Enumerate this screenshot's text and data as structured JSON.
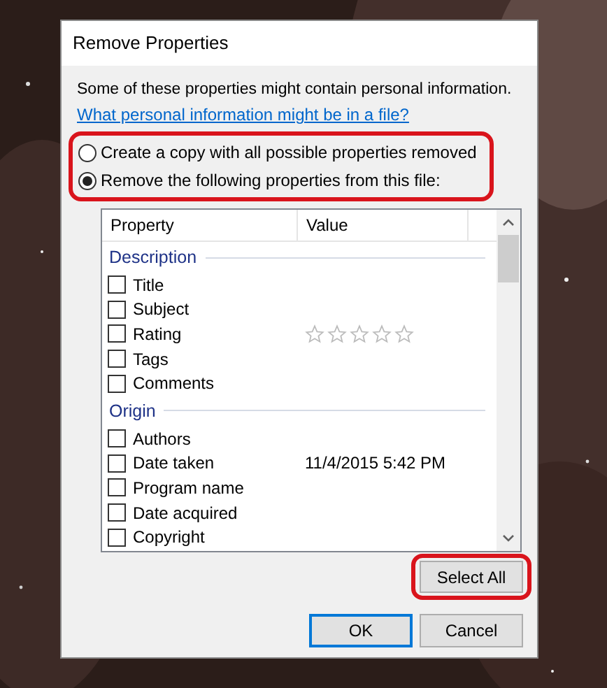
{
  "dialog": {
    "title": "Remove Properties",
    "intro": "Some of these properties might contain personal information.",
    "link": "What personal information might be in a file?",
    "options": [
      {
        "label": "Create a copy with all possible properties removed",
        "selected": false
      },
      {
        "label": "Remove the following properties from this file:",
        "selected": true
      }
    ],
    "options_highlighted": true,
    "columns": [
      "Property",
      "Value"
    ],
    "groups": [
      {
        "name": "Description",
        "rows": [
          {
            "kind": "text",
            "label": "Title",
            "checked": false
          },
          {
            "kind": "text",
            "label": "Subject",
            "checked": false
          },
          {
            "kind": "stars",
            "label": "Rating",
            "checked": false,
            "stars": 0
          },
          {
            "kind": "text",
            "label": "Tags",
            "checked": false
          },
          {
            "kind": "text",
            "label": "Comments",
            "checked": false
          }
        ]
      },
      {
        "name": "Origin",
        "rows": [
          {
            "kind": "text",
            "label": "Authors",
            "checked": false
          },
          {
            "kind": "text",
            "label": "Date taken",
            "checked": false,
            "value": "11/4/2015 5:42 PM"
          },
          {
            "kind": "text",
            "label": "Program name",
            "checked": false
          },
          {
            "kind": "text",
            "label": "Date acquired",
            "checked": false
          },
          {
            "kind": "text",
            "label": "Copyright",
            "checked": false
          }
        ]
      }
    ],
    "select_all": {
      "label": "Select All",
      "highlighted": true
    },
    "buttons": [
      {
        "label": "OK",
        "default": true
      },
      {
        "label": "Cancel",
        "default": false
      }
    ]
  }
}
